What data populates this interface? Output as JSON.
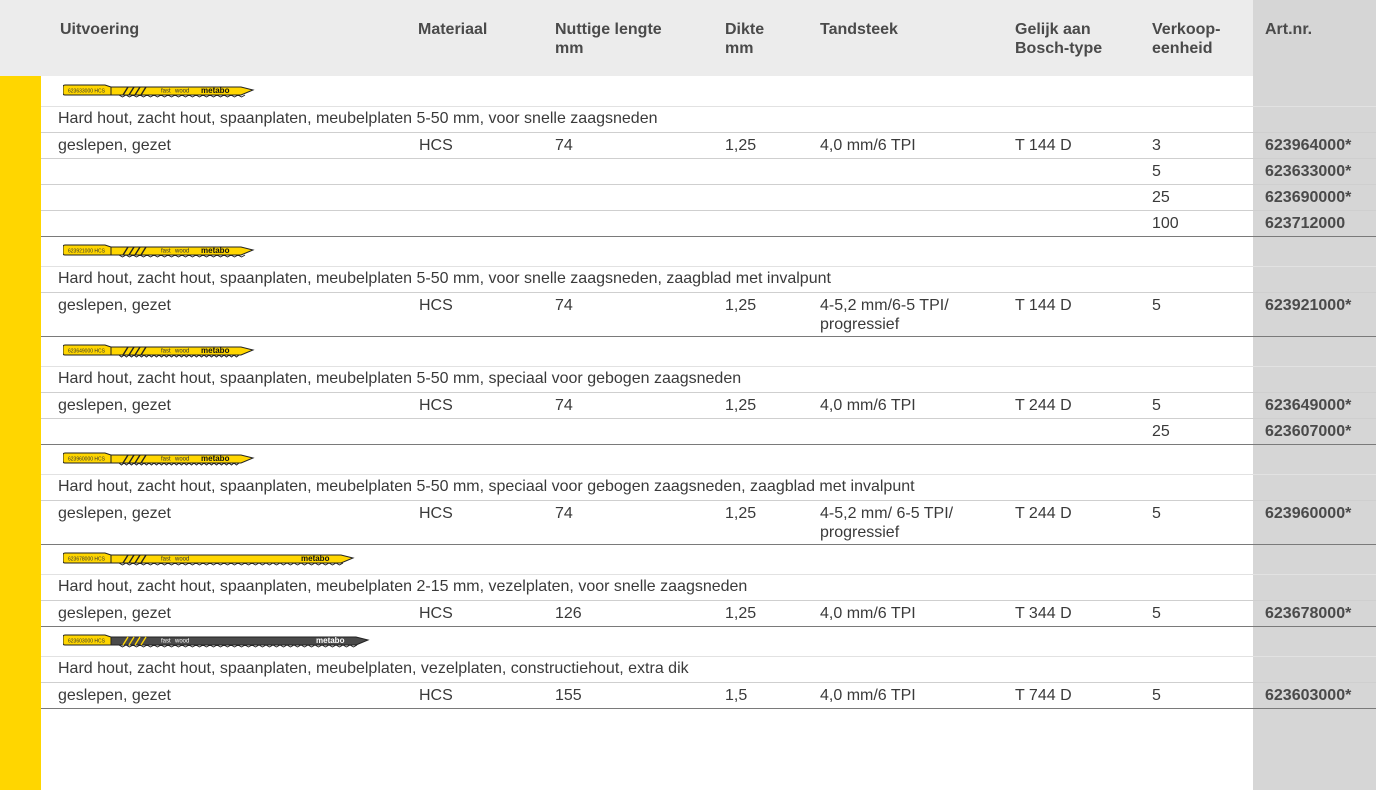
{
  "headers": {
    "uitvoering": "Uitvoering",
    "materiaal": "Materiaal",
    "lengte": "Nuttige lengte\nmm",
    "dikte": "Dikte\nmm",
    "tandsteek": "Tandsteek",
    "bosch": "Gelijk aan\nBosch-type",
    "verkoop": "Verkoop-\neenheid",
    "artnr": "Art.nr."
  },
  "colors": {
    "header_bg": "#ececec",
    "accent_yellow": "#ffd600",
    "artnr_bg": "#d6d6d6"
  },
  "groups": [
    {
      "blade": {
        "code": "623633000 HCS",
        "fast": "fast",
        "wood": "wood",
        "brand": "metabo",
        "style": "yellow-short"
      },
      "description": "Hard hout, zacht hout, spaanplaten, meubelplaten 5-50 mm, voor snelle zaagsneden",
      "rows": [
        {
          "uitvoering": "geslepen, gezet",
          "materiaal": "HCS",
          "lengte": "74",
          "dikte": "1,25",
          "tandsteek": "4,0 mm/6 TPI",
          "bosch": "T 144 D",
          "verkoop": "3",
          "artnr": "623964000*"
        },
        {
          "uitvoering": "",
          "materiaal": "",
          "lengte": "",
          "dikte": "",
          "tandsteek": "",
          "bosch": "",
          "verkoop": "5",
          "artnr": "623633000*"
        },
        {
          "uitvoering": "",
          "materiaal": "",
          "lengte": "",
          "dikte": "",
          "tandsteek": "",
          "bosch": "",
          "verkoop": "25",
          "artnr": "623690000*"
        },
        {
          "uitvoering": "",
          "materiaal": "",
          "lengte": "",
          "dikte": "",
          "tandsteek": "",
          "bosch": "",
          "verkoop": "100",
          "artnr": "623712000"
        }
      ]
    },
    {
      "blade": {
        "code": "623921000 HCS",
        "fast": "fast",
        "wood": "wood",
        "brand": "metabo",
        "style": "yellow-short"
      },
      "description": "Hard hout, zacht hout, spaanplaten, meubelplaten 5-50 mm, voor snelle zaagsneden, zaagblad met invalpunt",
      "rows": [
        {
          "uitvoering": "geslepen, gezet",
          "materiaal": "HCS",
          "lengte": "74",
          "dikte": "1,25",
          "tandsteek": "4-5,2 mm/6-5 TPI/\nprogressief",
          "bosch": "T 144 D",
          "verkoop": "5",
          "artnr": "623921000*"
        }
      ]
    },
    {
      "blade": {
        "code": "623649000 HCS",
        "fast": "fast",
        "wood": "wood",
        "brand": "metabo",
        "style": "yellow-fine"
      },
      "description": "Hard hout, zacht hout, spaanplaten, meubelplaten 5-50 mm, speciaal voor gebogen zaagsneden",
      "rows": [
        {
          "uitvoering": "geslepen, gezet",
          "materiaal": "HCS",
          "lengte": "74",
          "dikte": "1,25",
          "tandsteek": "4,0 mm/6 TPI",
          "bosch": "T 244 D",
          "verkoop": "5",
          "artnr": "623649000*"
        },
        {
          "uitvoering": "",
          "materiaal": "",
          "lengte": "",
          "dikte": "",
          "tandsteek": "",
          "bosch": "",
          "verkoop": "25",
          "artnr": "623607000*"
        }
      ]
    },
    {
      "blade": {
        "code": "623960000 HCS",
        "fast": "fast",
        "wood": "wood",
        "brand": "metabo",
        "style": "yellow-fine"
      },
      "description": "Hard hout, zacht hout, spaanplaten, meubelplaten 5-50 mm, speciaal voor gebogen zaagsneden, zaagblad met invalpunt",
      "rows": [
        {
          "uitvoering": "geslepen, gezet",
          "materiaal": "HCS",
          "lengte": "74",
          "dikte": "1,25",
          "tandsteek": "4-5,2 mm/ 6-5 TPI/\nprogressief",
          "bosch": "T 244 D",
          "verkoop": "5",
          "artnr": "623960000*"
        }
      ]
    },
    {
      "blade": {
        "code": "623678000 HCS",
        "fast": "fast",
        "wood": "wood",
        "brand": "metabo",
        "style": "yellow-long"
      },
      "description": "Hard hout, zacht hout, spaanplaten, meubelplaten 2-15 mm, vezelplaten, voor snelle zaagsneden",
      "rows": [
        {
          "uitvoering": "geslepen, gezet",
          "materiaal": "HCS",
          "lengte": "126",
          "dikte": "1,25",
          "tandsteek": "4,0 mm/6 TPI",
          "bosch": "T 344 D",
          "verkoop": "5",
          "artnr": "623678000*"
        }
      ]
    },
    {
      "blade": {
        "code": "623603000 HCS",
        "fast": "fast",
        "wood": "wood",
        "brand": "metabo",
        "style": "dark-long"
      },
      "description": "Hard hout, zacht hout, spaanplaten, meubelplaten, vezelplaten, constructiehout, extra dik",
      "rows": [
        {
          "uitvoering": "geslepen, gezet",
          "materiaal": "HCS",
          "lengte": "155",
          "dikte": "1,5",
          "tandsteek": "4,0 mm/6 TPI",
          "bosch": "T 744 D",
          "verkoop": "5",
          "artnr": "623603000*"
        }
      ]
    }
  ]
}
